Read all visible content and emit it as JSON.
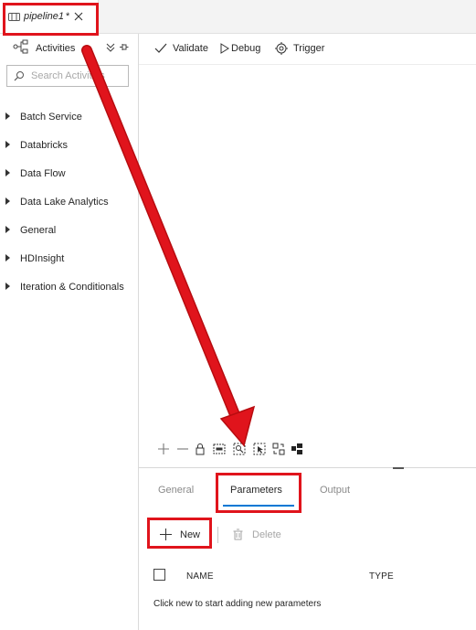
{
  "tab": {
    "title": "pipeline1",
    "dirty_marker": "*"
  },
  "activities": {
    "header_label": "Activities",
    "search_placeholder": "Search Activities",
    "categories": [
      "Batch Service",
      "Databricks",
      "Data Flow",
      "Data Lake Analytics",
      "General",
      "HDInsight",
      "Iteration & Conditionals"
    ]
  },
  "toolbar": {
    "validate": "Validate",
    "debug": "Debug",
    "trigger": "Trigger"
  },
  "canvas_tools": [
    "add-icon",
    "remove-icon",
    "lock-icon",
    "zoom-100-icon",
    "zoom-fit-icon",
    "select-icon",
    "autolayout-icon",
    "layout-icon"
  ],
  "bottom_tabs": {
    "general": "General",
    "parameters": "Parameters",
    "output": "Output",
    "active": "Parameters"
  },
  "params": {
    "new_label": "New",
    "delete_label": "Delete",
    "col_name": "NAME",
    "col_type": "TYPE",
    "empty_message": "Click new to start adding new parameters"
  },
  "colors": {
    "annotation": "#e0141c",
    "accent": "#0078d4"
  }
}
